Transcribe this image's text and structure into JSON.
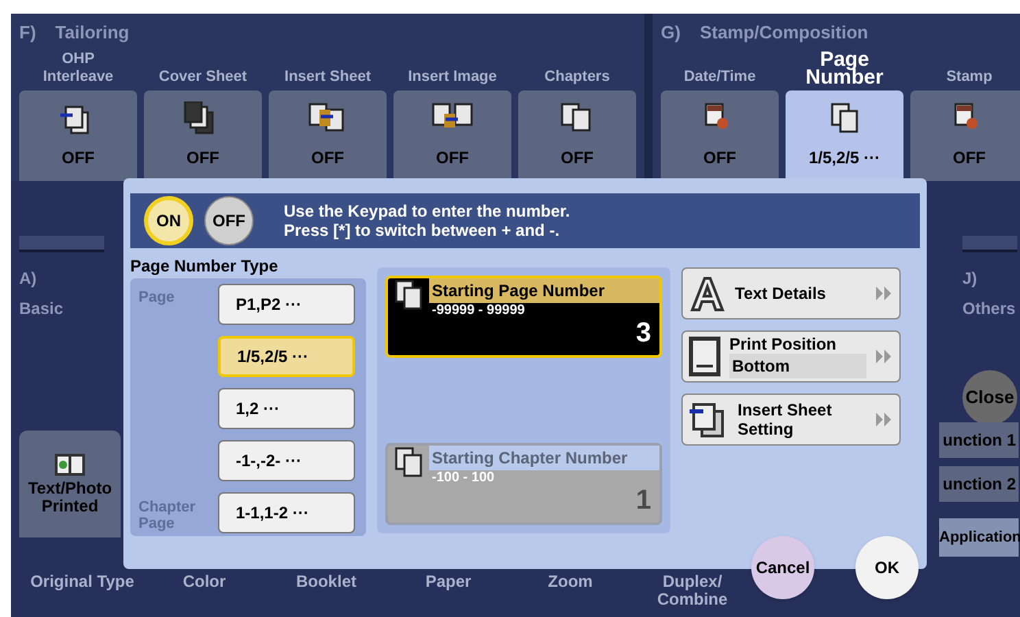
{
  "sections": [
    {
      "letter": "F)",
      "title": "Tailoring",
      "functions": [
        {
          "kind": "interleave",
          "label": "OHP\nInterleave",
          "value": "OFF",
          "selected": false
        },
        {
          "kind": "cover",
          "label": "Cover Sheet",
          "value": "OFF",
          "selected": false
        },
        {
          "kind": "insert-sheet",
          "label": "Insert Sheet",
          "value": "OFF",
          "selected": false
        },
        {
          "kind": "insert-image",
          "label": "Insert Image",
          "value": "OFF",
          "selected": false
        },
        {
          "kind": "chapters",
          "label": "Chapters",
          "value": "OFF",
          "selected": false
        }
      ]
    },
    {
      "letter": "G)",
      "title": "Stamp/Composition",
      "functions": [
        {
          "kind": "date-time",
          "label": "Date/Time",
          "value": "OFF",
          "selected": false
        },
        {
          "kind": "page-number",
          "label": "Page Number",
          "value": "1/5,2/5 ···",
          "selected": true
        },
        {
          "kind": "stamp",
          "label": "Stamp",
          "value": "OFF",
          "selected": false
        }
      ]
    }
  ],
  "side_tabs": [
    {
      "letter": "A)",
      "label": "Basic"
    },
    {
      "letter": "J)",
      "label": "Others"
    }
  ],
  "close_button": "Close",
  "original_type_button": "Text/Photo\nPrinted",
  "function_keys": [
    "unction 1",
    "unction 2"
  ],
  "application_tab": "Application",
  "bottom_tabs": [
    "Original Type",
    "Color",
    "Booklet",
    "Paper",
    "Zoom",
    "Duplex/\nCombine"
  ],
  "dialog": {
    "toggle": [
      {
        "label": "ON",
        "selected": true
      },
      {
        "label": "OFF",
        "selected": false
      }
    ],
    "message": "Use the Keypad to enter the number.\nPress [*] to switch between + and -.",
    "type_panel": {
      "title": "Page Number Type",
      "groups": [
        {
          "label": "Page",
          "options": [
            {
              "label": "P1,P2 ···",
              "selected": false
            },
            {
              "label": "1/5,2/5 ···",
              "selected": true
            },
            {
              "label": "1,2 ···",
              "selected": false
            },
            {
              "label": "-1-,-2- ···",
              "selected": false
            }
          ]
        },
        {
          "label": "Chapter\nPage",
          "options": [
            {
              "label": "1-1,1-2 ···",
              "selected": false
            }
          ]
        }
      ]
    },
    "fields": [
      {
        "label": "Starting Page Number",
        "range": "-99999 - 99999",
        "value": "3",
        "selected": true,
        "disabled": false
      },
      {
        "label": "Starting Chapter Number",
        "range": "-100 - 100",
        "value": "1",
        "selected": false,
        "disabled": true
      }
    ],
    "settings": [
      {
        "kind": "text",
        "label": "Text Details"
      },
      {
        "kind": "position",
        "label": "Print Position",
        "value": "Bottom"
      },
      {
        "kind": "insert",
        "label": "Insert Sheet\nSetting"
      }
    ],
    "actions": [
      {
        "kind": "cancel",
        "label": "Cancel"
      },
      {
        "kind": "ok",
        "label": "OK"
      }
    ]
  }
}
